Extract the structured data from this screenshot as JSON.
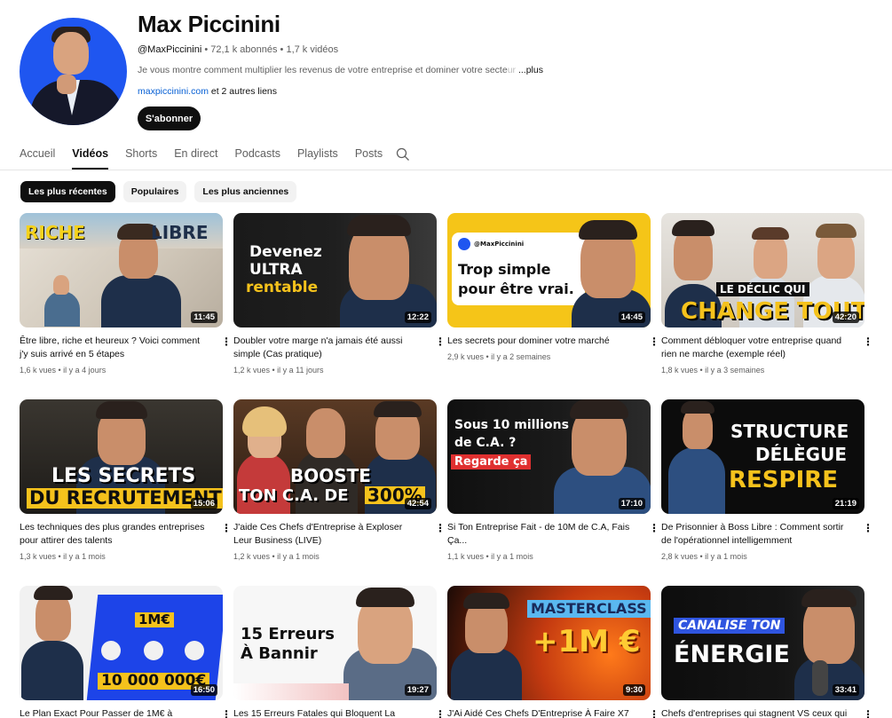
{
  "channel": {
    "name": "Max Piccinini",
    "handle": "@MaxPiccinini",
    "meta": " • 72,1 k abonnés • 1,7 k vidéos",
    "description": "Je vous montre comment multiplier les revenus de votre entreprise et dominer votre secte",
    "description_fade": "ur",
    "more_label": "...plus",
    "site": "maxpiccinini.com",
    "links_suffix": " et 2 autres liens",
    "subscribe_label": "S'abonner"
  },
  "tabs": [
    "Accueil",
    "Vidéos",
    "Shorts",
    "En direct",
    "Podcasts",
    "Playlists",
    "Posts"
  ],
  "active_tab": "Vidéos",
  "chips": [
    "Les plus récentes",
    "Populaires",
    "Les plus anciennes"
  ],
  "videos": [
    {
      "title": "Être libre, riche et heureux ? Voici comment j'y suis arrivé en 5 étapes",
      "meta": "1,6 k vues • il y a 4 jours",
      "duration": "11:45",
      "thumb_text_1": "RICHE",
      "thumb_text_2": "LIBRE"
    },
    {
      "title": "Doubler votre marge n'a jamais été aussi simple (Cas pratique)",
      "meta": "1,2 k vues • il y a 11 jours",
      "duration": "12:22",
      "thumb_text_1": "Devenez",
      "thumb_text_2": "ULTRA",
      "thumb_text_3": "rentable"
    },
    {
      "title": "Les secrets pour dominer votre marché",
      "meta": "2,9 k vues • il y a 2 semaines",
      "duration": "14:45",
      "thumb_text_1": "@MaxPiccinini",
      "thumb_text_2": "Trop simple",
      "thumb_text_3": "pour être vrai."
    },
    {
      "title": "Comment débloquer votre entreprise quand rien ne marche (exemple réel)",
      "meta": "1,8 k vues • il y a 3 semaines",
      "duration": "42:20",
      "thumb_text_1": "LE DÉCLIC QUI",
      "thumb_text_2": "CHANGE TOUT"
    },
    {
      "title": "Les techniques des plus grandes entreprises pour attirer des talents",
      "meta": "1,3 k vues • il y a 1 mois",
      "duration": "15:06",
      "thumb_text_1": "LES SECRETS",
      "thumb_text_2": "DU RECRUTEMENT"
    },
    {
      "title": "J'aide Ces Chefs d'Entreprise à Exploser Leur Business (LIVE)",
      "meta": "1,2 k vues • il y a 1 mois",
      "duration": "42:54",
      "thumb_text_1": "BOOSTE",
      "thumb_text_2": "TON C.A. DE",
      "thumb_text_3": "300%"
    },
    {
      "title": "Si Ton Entreprise Fait - de 10M de C.A, Fais Ça...",
      "meta": "1,1 k vues • il y a 1 mois",
      "duration": "17:10",
      "thumb_text_1": "Sous 10 millions",
      "thumb_text_2": "de C.A. ?",
      "thumb_text_3": "Regarde ça"
    },
    {
      "title": "De Prisonnier à Boss Libre : Comment sortir de l'opérationnel intelligemment",
      "meta": "2,8 k vues • il y a 1 mois",
      "duration": "21:19",
      "thumb_text_1": "STRUCTURE",
      "thumb_text_2": "DÉLÈGUE",
      "thumb_text_3": "RESPIRE"
    },
    {
      "title": "Le Plan Exact Pour Passer de 1M€ à",
      "meta": "",
      "duration": "16:50",
      "thumb_text_1": "1M€",
      "thumb_text_2": "10 000 000€"
    },
    {
      "title": "Les 15 Erreurs Fatales qui Bloquent La",
      "meta": "",
      "duration": "19:27",
      "thumb_text_1": "15 Erreurs",
      "thumb_text_2": "À Bannir"
    },
    {
      "title": "J'Ai Aidé Ces Chefs D'Entreprise À Faire X7",
      "meta": "",
      "duration": "9:30",
      "thumb_text_1": "MASTERCLASS",
      "thumb_text_2": "+1M €"
    },
    {
      "title": "Chefs d'entreprises qui stagnent VS ceux qui",
      "meta": "",
      "duration": "33:41",
      "thumb_text_1": "CANALISE TON",
      "thumb_text_2": "ÉNERGIE"
    }
  ]
}
